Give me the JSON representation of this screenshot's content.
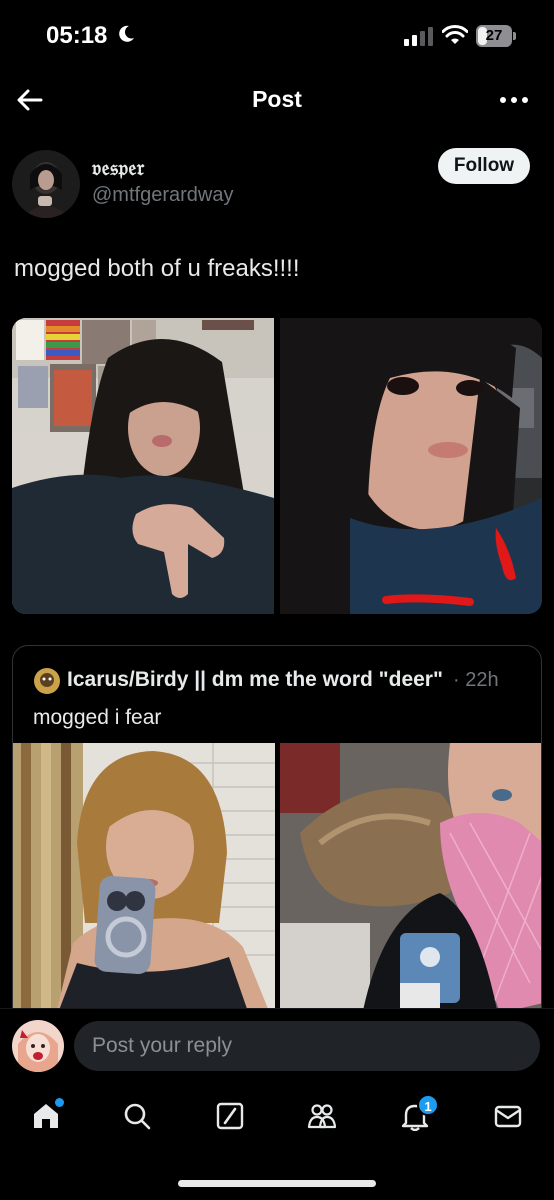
{
  "status_bar": {
    "time": "05:18",
    "battery": "27",
    "battery_level": 0.27
  },
  "header": {
    "title": "Post"
  },
  "post": {
    "display_name": "𝔳𝔢𝔰𝔭𝔢𝔯",
    "handle": "@mtfgerardway",
    "follow_label": "Follow",
    "text": "mogged both of u freaks!!!!"
  },
  "quote": {
    "display_name": "Icarus/Birdy || dm me the word \"deer\"",
    "time": "· 22h",
    "text": "mogged i fear"
  },
  "reply": {
    "placeholder": "Post your reply"
  },
  "nav": {
    "items": [
      "home-icon",
      "search-icon",
      "grok-icon",
      "communities-icon",
      "notifications-icon",
      "messages-icon"
    ],
    "notification_count": "1"
  },
  "colors": {
    "background": "#000000",
    "text": "#e7e9ea",
    "secondary_text": "#71767b",
    "accent": "#1d9bf0"
  }
}
